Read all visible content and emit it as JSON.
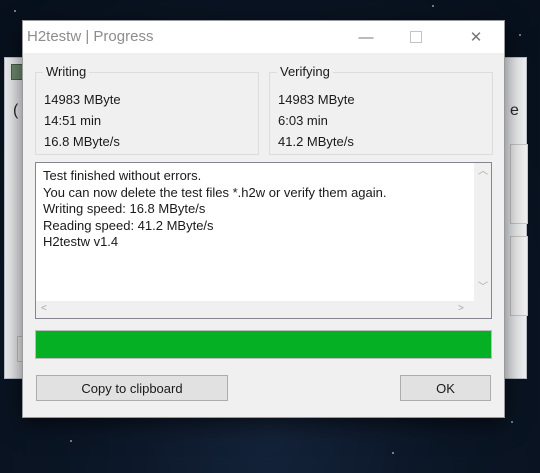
{
  "window": {
    "title": "H2testw | Progress",
    "controls": {
      "minimize": "—",
      "close": "✕"
    }
  },
  "writing": {
    "title": "Writing",
    "size": "14983 MByte",
    "time": "14:51 min",
    "speed": "16.8 MByte/s"
  },
  "verifying": {
    "title": "Verifying",
    "size": "14983 MByte",
    "time": "6:03 min",
    "speed": "41.2 MByte/s"
  },
  "log": {
    "lines": [
      "Test finished without errors.",
      "You can now delete the test files *.h2w or verify them again.",
      "Writing speed: 16.8 MByte/s",
      "Reading speed: 41.2 MByte/s",
      "H2testw v1.4"
    ]
  },
  "progress": {
    "fraction": 1.0,
    "color": "#06b025"
  },
  "buttons": {
    "copy": "Copy to clipboard",
    "ok": "OK"
  }
}
